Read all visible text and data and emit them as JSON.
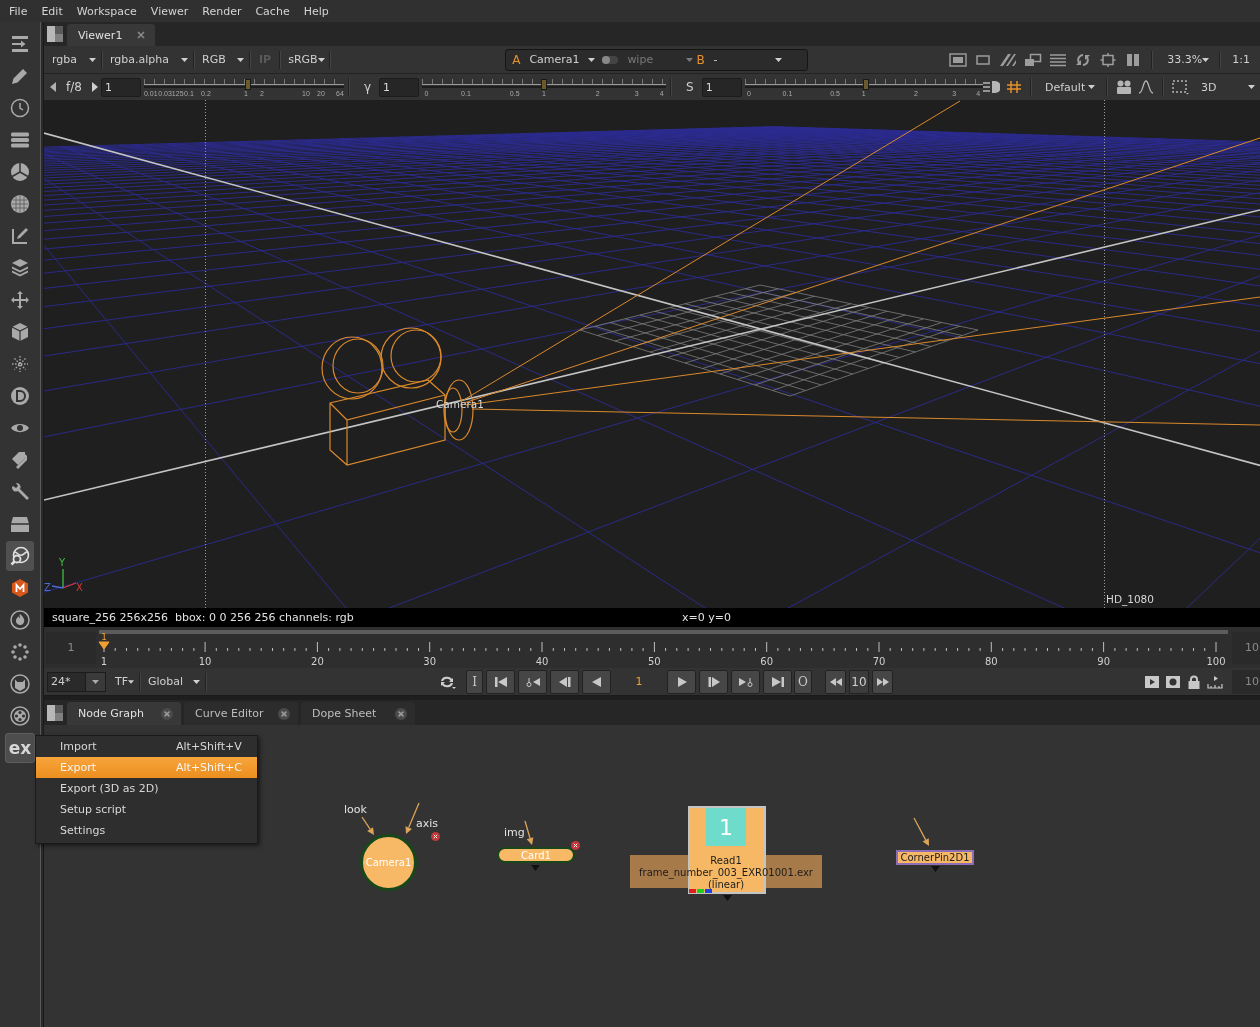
{
  "menu_bar": {
    "items": [
      "File",
      "Edit",
      "Workspace",
      "Viewer",
      "Render",
      "Cache",
      "Help"
    ]
  },
  "toolbar": {
    "tools": [
      {
        "selected": false
      },
      {
        "selected": false
      },
      {
        "selected": false
      },
      {
        "selected": false
      },
      {
        "selected": false
      },
      {
        "selected": false
      },
      {
        "selected": false
      },
      {
        "selected": false
      },
      {
        "selected": false
      },
      {
        "selected": false
      },
      {
        "selected": false
      },
      {
        "selected": false
      },
      {
        "selected": false
      },
      {
        "selected": false
      },
      {
        "selected": false
      },
      {
        "selected": false
      },
      {
        "selected": true
      },
      {
        "selected": false
      },
      {
        "selected": false
      },
      {
        "selected": false
      },
      {
        "selected": false
      },
      {
        "selected": false
      }
    ],
    "ex_button": {
      "label": "ex",
      "selected": true
    }
  },
  "viewer": {
    "tabs": [
      {
        "label": "Viewer1",
        "selected": true
      }
    ],
    "row1": {
      "channels": "rgba",
      "alpha_channel": "rgba.alpha",
      "display": "RGB",
      "ip": {
        "label": "IP",
        "disabled": true
      },
      "lut": "sRGB",
      "input_a": {
        "letter": "A",
        "value": "Camera1"
      },
      "wipe": {
        "label": "wipe",
        "on": false
      },
      "input_b": {
        "letter": "B",
        "value": "-"
      },
      "zoom": "33.3%",
      "proxy": "1:1"
    },
    "row2": {
      "sliders": [
        {
          "kind": "gain",
          "label": "f/8",
          "value": "1",
          "level": 0.52,
          "ticks": [
            "0.01",
            "0.03125",
            "0.1",
            "0.2",
            "1",
            "2",
            "10",
            "20",
            "64"
          ]
        },
        {
          "kind": "gamma",
          "label": "γ",
          "value": "1",
          "level": 0.5,
          "ticks": [
            "0",
            "0.1",
            "0.5",
            "1",
            "2",
            "3",
            "4"
          ]
        },
        {
          "kind": "saturation",
          "label": "S",
          "value": "1",
          "level": 0.51,
          "ticks": [
            "0",
            "0.1",
            "0.5",
            "1",
            "2",
            "3",
            "4"
          ]
        }
      ],
      "grid_overlay": {
        "on": true
      },
      "preset": "Default",
      "view_mode": "3D"
    }
  },
  "scene": {
    "camera_label": "Camera1",
    "format_label": "HD_1080",
    "axis_labels": [
      "Y",
      "Z",
      "X"
    ]
  },
  "info_bar": {
    "image": "square_256 256x256  bbox: 0 0 256 256 channels: rgb",
    "cursor": "x=0 y=0"
  },
  "timeline": {
    "start": "1",
    "end": "10",
    "labels": [
      "1",
      "10",
      "20",
      "30",
      "40",
      "50",
      "60",
      "70",
      "80",
      "90",
      "100"
    ],
    "playhead": {
      "label": "1",
      "level": 0
    }
  },
  "transport": {
    "fps": "24*",
    "time_mode": "TF",
    "range": "Global",
    "back_buttons": [
      {
        "kind": "text",
        "label": "I"
      },
      {
        "kind": "first"
      },
      {
        "kind": "prev_key"
      },
      {
        "kind": "prev_frame"
      },
      {
        "kind": "play_back"
      }
    ],
    "frame": "1",
    "forward_buttons": [
      {
        "kind": "play"
      },
      {
        "kind": "next_frame"
      },
      {
        "kind": "next_key"
      },
      {
        "kind": "last"
      },
      {
        "kind": "text",
        "label": "O"
      }
    ],
    "increment": "10",
    "end_frame": "10"
  },
  "node_graph": {
    "tabs": [
      {
        "label": "Node Graph",
        "selected": true
      },
      {
        "label": "Curve Editor",
        "selected": false
      },
      {
        "label": "Dope Sheet",
        "selected": false
      }
    ],
    "nodes": [
      {
        "kind": "camera",
        "label": "Camera1",
        "inputs": [
          "look",
          "axis"
        ]
      },
      {
        "kind": "card",
        "label": "Card1",
        "inputs": [
          "img"
        ]
      },
      {
        "kind": "read",
        "label": "Read1",
        "thumbnail": "1",
        "file": "frame_number_003_EXR01001.exr",
        "colorspace": "(linear)"
      },
      {
        "kind": "cornerpin",
        "label": "CornerPin2D1"
      }
    ]
  },
  "export_menu": {
    "items": [
      {
        "label": "Import",
        "shortcut": "Alt+Shift+V",
        "selected": false
      },
      {
        "label": "Export",
        "shortcut": "Alt+Shift+C",
        "selected": true
      },
      {
        "label": "Export (3D as 2D)",
        "selected": false
      },
      {
        "label": "Setup script",
        "selected": false
      },
      {
        "label": "Settings",
        "selected": false
      }
    ]
  }
}
